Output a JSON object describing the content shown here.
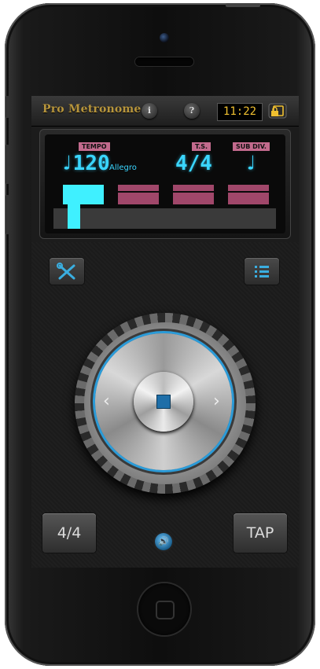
{
  "app": {
    "title": "Pro Metronome",
    "clock": "11:22"
  },
  "topbar": {
    "info_label": "i",
    "help_label": "?"
  },
  "display": {
    "tempo_tag": "TEMPO",
    "ts_tag": "T.S.",
    "subdiv_tag": "SUB DIV.",
    "tempo_value": "♩120",
    "tempo_marking": "Allegro",
    "time_signature": "4/4",
    "subdivision": "♩",
    "beats": 4,
    "active_beat": 1
  },
  "controls": {
    "settings_icon": "wrench-screwdriver-icon",
    "list_icon": "list-icon",
    "time_signature_button": "4/4",
    "tap_button": "TAP",
    "prev_arrow": "‹",
    "next_arrow": "›",
    "sound_icon": "speaker-icon"
  },
  "colors": {
    "accent_cyan": "#3ff0ff",
    "beat_pink": "#a0476a",
    "title_gold": "#b7953c",
    "clock_yellow": "#f0c030",
    "dial_blue": "#2b9bd8"
  }
}
